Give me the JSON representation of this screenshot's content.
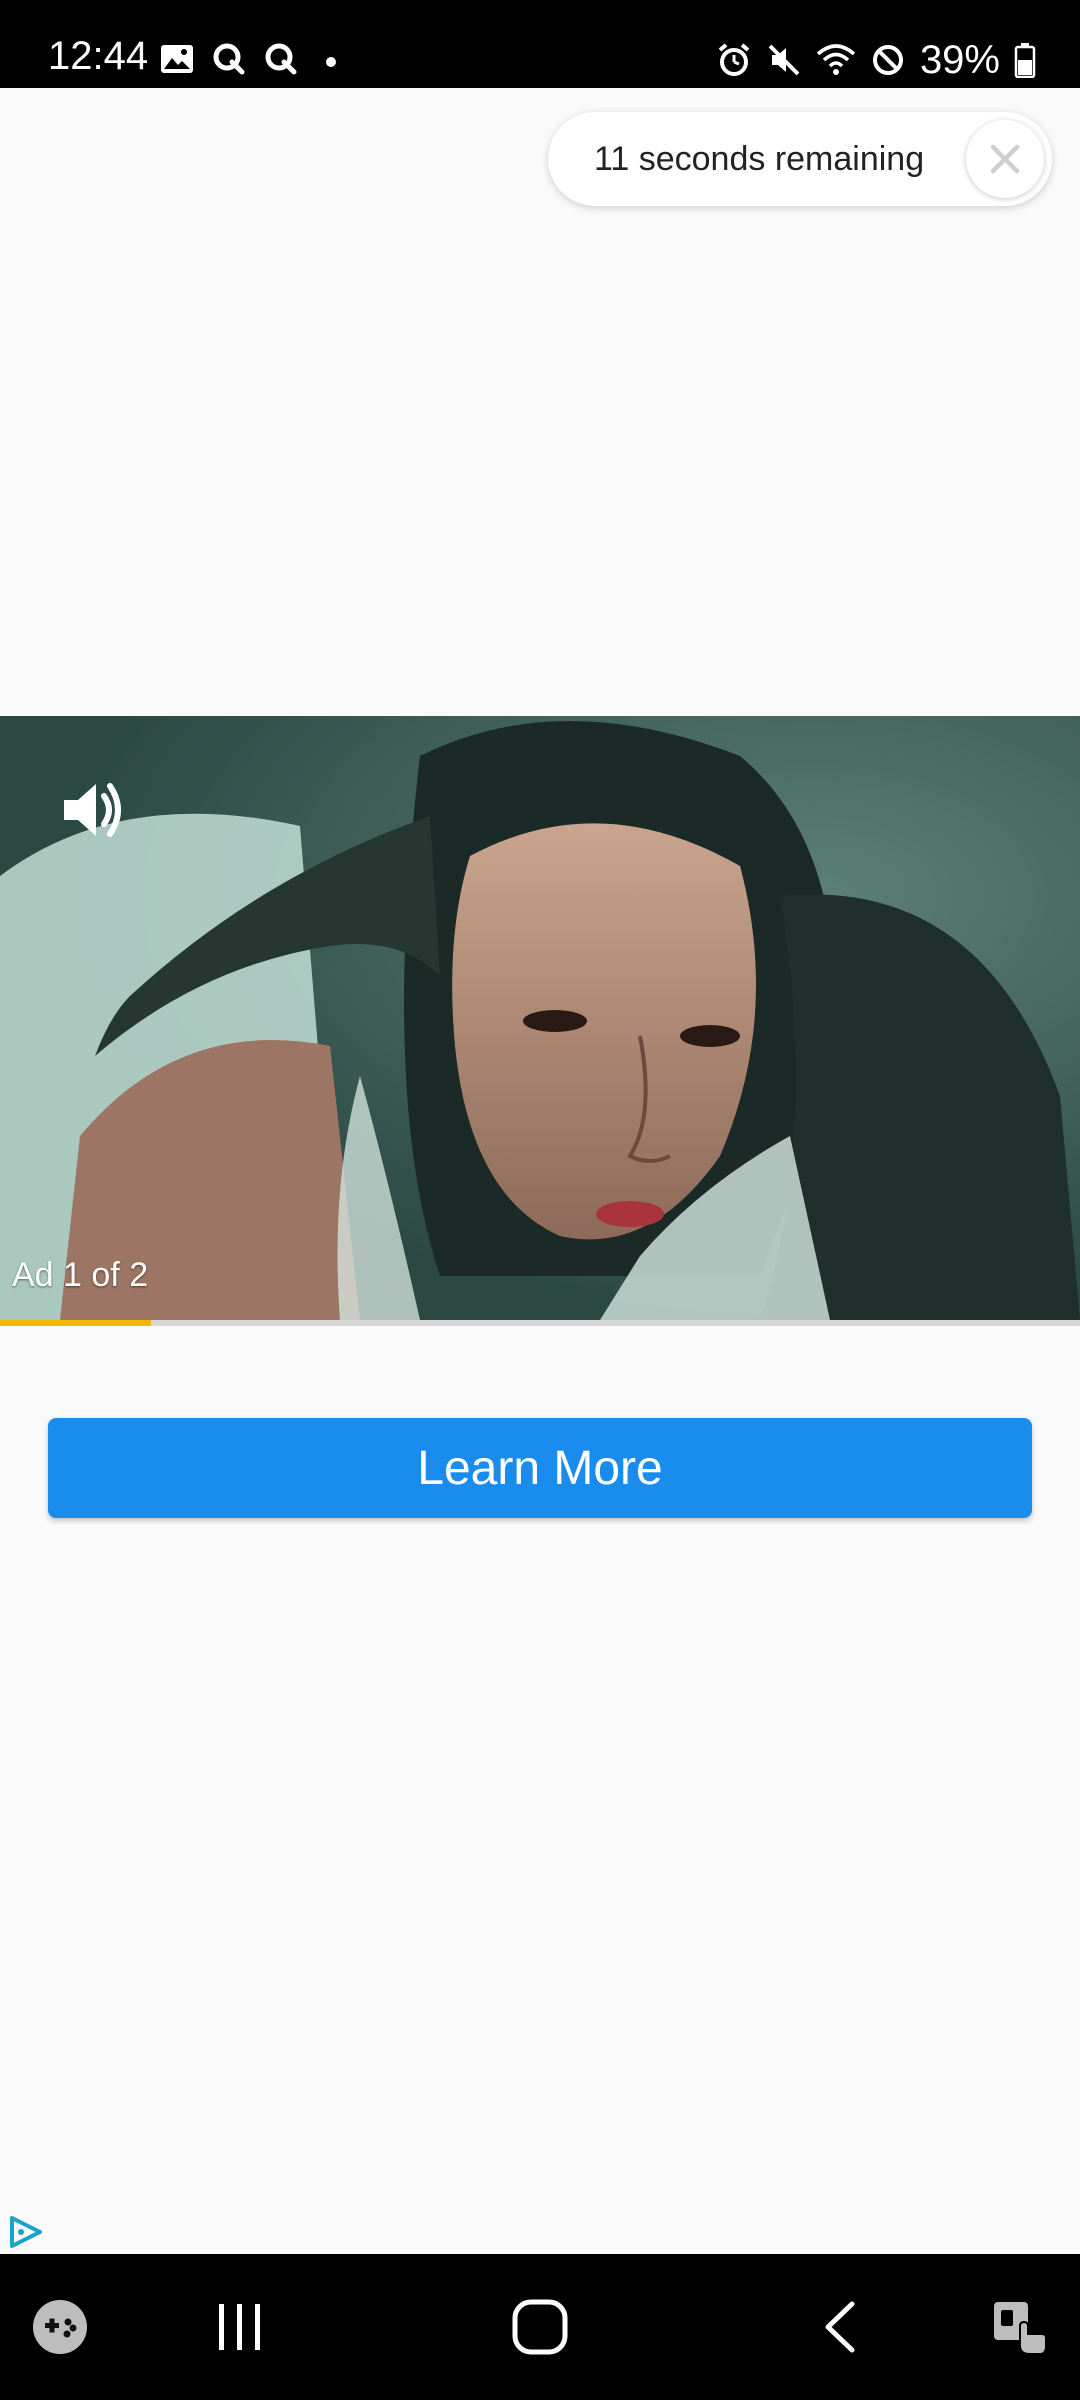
{
  "status_bar": {
    "time": "12:44",
    "battery_percent": "39%",
    "left_icons": [
      "image-icon",
      "q-app-icon",
      "q-app-icon",
      "dot-icon"
    ],
    "right_icons": [
      "alarm-icon",
      "mute-icon",
      "wifi-icon",
      "do-not-disturb-icon",
      "battery-icon"
    ]
  },
  "ad": {
    "skip_text": "11 seconds remaining",
    "close_icon": "close-icon",
    "counter": "Ad 1 of 2",
    "progress": 0.14,
    "progress_color": "#f4b400",
    "sound_icon": "volume-icon",
    "cta_label": "Learn More",
    "cta_color": "#1a8cee",
    "adchoices_icon": "adchoices-icon"
  },
  "nav_bar": {
    "items": [
      "game-launcher-icon",
      "recent-apps-icon",
      "home-icon",
      "back-icon",
      "accessibility-icon"
    ]
  }
}
